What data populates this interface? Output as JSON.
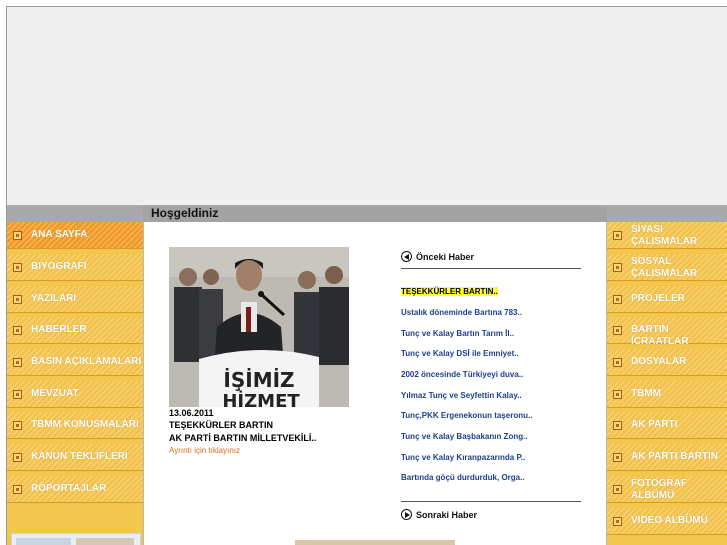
{
  "page": {
    "title": "Hoşgeldiniz"
  },
  "left_menu": [
    {
      "label": "ANA SAYFA",
      "active": true
    },
    {
      "label": "BIYOGRAFI"
    },
    {
      "label": "YAZILARI"
    },
    {
      "label": "HABERLER"
    },
    {
      "label": "BASIN AÇIKLAMALARI"
    },
    {
      "label": "MEVZUAT"
    },
    {
      "label": "TBMM KONUSMALARI"
    },
    {
      "label": "KANUN TEKLIFLERI"
    },
    {
      "label": "RÖPORTAJLAR"
    }
  ],
  "right_menu": [
    {
      "label": "SIYASI ÇALISMALAR"
    },
    {
      "label": "SOSYAL ÇALISMALAR"
    },
    {
      "label": "PROJELER"
    },
    {
      "label": "BARTIN İCRAATLAR"
    },
    {
      "label": "DOSYALAR"
    },
    {
      "label": "TBMM"
    },
    {
      "label": "AK PARTI"
    },
    {
      "label": "AK PARTI BARTIN"
    },
    {
      "label": "FOTOGRAF ALBÜMÜ"
    },
    {
      "label": "VIDEO ALBÜMÜ"
    }
  ],
  "featured": {
    "photo_sign": "İŞİMİZ HİZMET",
    "date": "13.06.2011",
    "title": "TEŞEKKÜRLER BARTIN",
    "subtitle": "AK PARTİ BARTIN MİLLETVEKİLİ..",
    "more_link": "Ayrıntı için tıklayınız"
  },
  "news_nav": {
    "prev_label": "Önceki Haber",
    "next_label": "Sonraki Haber"
  },
  "headlines": [
    "TEŞEKKÜRLER BARTIN..",
    "Ustalık döneminde Bartına 783..",
    "Tunç ve Kalay Bartın Tarım İl..",
    "Tunç ve Kalay DSİ ile Emniyet..",
    "2002 öncesinde Türkiyeyi duva..",
    "Yılmaz Tunç ve Seyfettin Kalay..",
    "Tunç,PKK Ergenekonun taşeronu..",
    "Tunç ve Kalay Başbakanın Zong..",
    "Tunç ve Kalay Kıranpazarında P..",
    "Bartında göçü durdurduk, Orga.."
  ],
  "colors": {
    "menu": "#f2c24a",
    "menu_active": "#f29a26",
    "headline": "#1c3f8c",
    "highlight": "#ffff33",
    "more_link": "#e06a1a"
  }
}
